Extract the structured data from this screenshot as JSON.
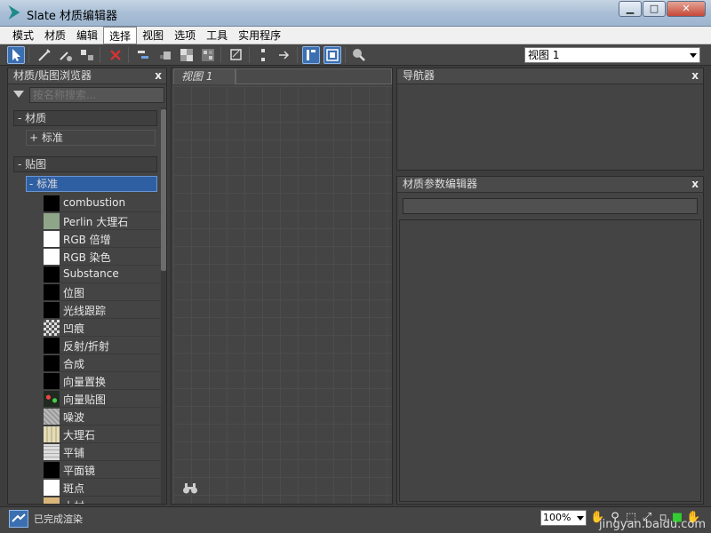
{
  "window": {
    "title": "Slate 材质编辑器",
    "minimize": "▁",
    "maximize": "□",
    "close": "✕"
  },
  "menu": [
    "模式",
    "材质",
    "编辑",
    "选择",
    "视图",
    "选项",
    "工具",
    "实用程序"
  ],
  "menu_active_index": 3,
  "toolbar": {
    "view_select_value": "视图 1"
  },
  "browser": {
    "title": "材质/贴图浏览器",
    "close": "x",
    "search_placeholder": "按名称搜索...",
    "materials_group": "- 材质",
    "materials_standard": "+ 标准",
    "maps_group": "- 贴图",
    "maps_standard": "- 标准",
    "items": [
      {
        "label": "combustion",
        "color": "#000000"
      },
      {
        "label": "Perlin 大理石",
        "color": "#8fa58a"
      },
      {
        "label": "RGB 倍增",
        "color": "#ffffff"
      },
      {
        "label": "RGB 染色",
        "color": "#ffffff"
      },
      {
        "label": "Substance",
        "color": "#000000"
      },
      {
        "label": "位图",
        "color": "#000000"
      },
      {
        "label": "光线跟踪",
        "color": "#000000"
      },
      {
        "label": "凹痕",
        "color": "#9a9a9a"
      },
      {
        "label": "反射/折射",
        "color": "#000000"
      },
      {
        "label": "合成",
        "color": "#000000"
      },
      {
        "label": "向量置换",
        "color": "#000000"
      },
      {
        "label": "向量贴图",
        "color": "#202a20"
      },
      {
        "label": "噪波",
        "color": "#b0b0b0"
      },
      {
        "label": "大理石",
        "color": "#e4dcb8"
      },
      {
        "label": "平铺",
        "color": "#cfcfcf"
      },
      {
        "label": "平面镜",
        "color": "#000000"
      },
      {
        "label": "斑点",
        "color": "#ffffff"
      },
      {
        "label": "木材",
        "color": "#d9b77a"
      }
    ]
  },
  "view": {
    "tab_label": "视图 1"
  },
  "navigator": {
    "title": "导航器",
    "close": "x"
  },
  "param_editor": {
    "title": "材质参数编辑器",
    "close": "x"
  },
  "status": {
    "text": "已完成渲染",
    "zoom": "100%",
    "watermark": "jingyan.baidu.com"
  }
}
